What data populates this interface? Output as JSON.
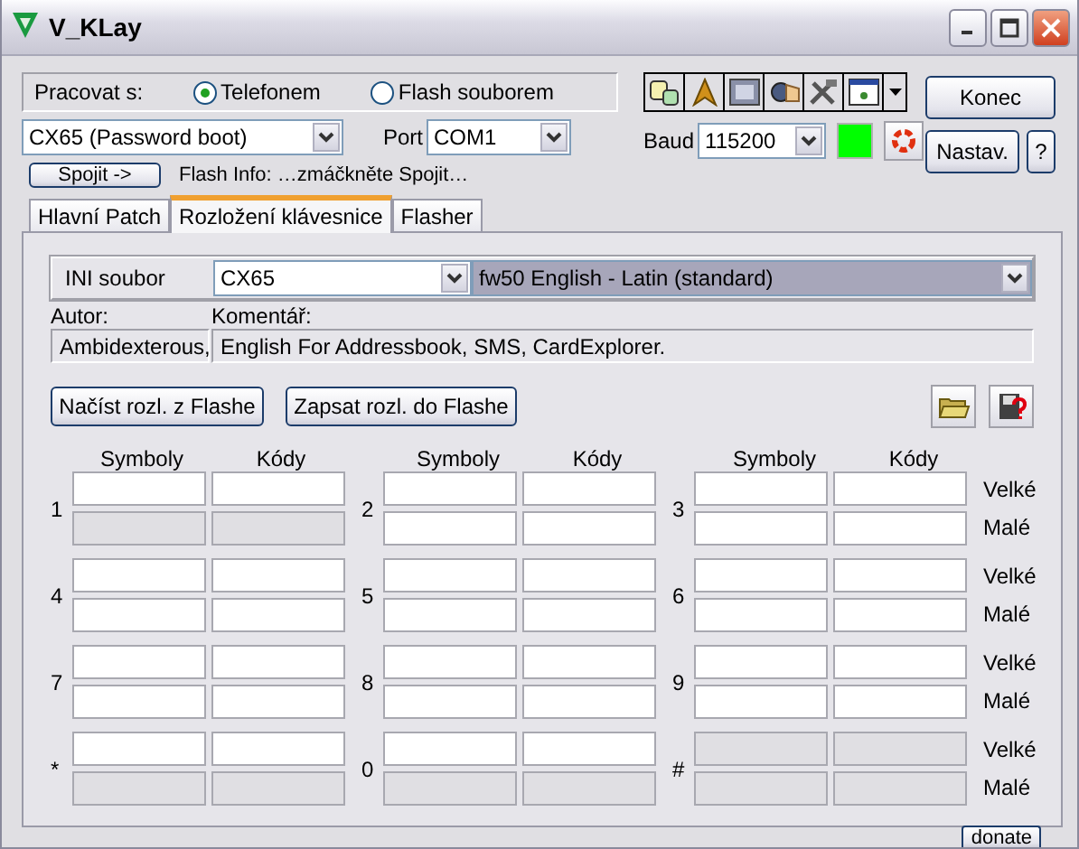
{
  "window": {
    "title": "V_KLay"
  },
  "work_with": {
    "label": "Pracovat s:",
    "options": [
      {
        "label": "Telefonem",
        "selected": true
      },
      {
        "label": "Flash souborem",
        "selected": false
      }
    ]
  },
  "phone_select": {
    "value": "CX65 (Password boot)"
  },
  "port": {
    "label": "Port",
    "value": "COM1"
  },
  "baud": {
    "label": "Baud",
    "value": "115200"
  },
  "connect_button": "Spojit ->",
  "flash_info": "Flash Info: …zmáčkněte Spojit…",
  "close_button": "Konec",
  "settings_button": "Nastav.",
  "help_button": "?",
  "tabs": [
    {
      "label": "Hlavní Patch",
      "selected": false
    },
    {
      "label": "Rozložení klávesnice",
      "selected": true
    },
    {
      "label": "Flasher",
      "selected": false
    }
  ],
  "ini": {
    "label": "INI soubor",
    "file": "CX65",
    "layout": "fw50 English - Latin (standard)",
    "author_label": "Autor:",
    "author": "Ambidexterous,",
    "comment_label": "Komentář:",
    "comment": "English For Addressbook, SMS, CardExplorer."
  },
  "load_button": "Načíst rozl. z Flashe",
  "save_button": "Zapsat rozl. do Flashe",
  "grid": {
    "columns": [
      {
        "symbols": "Symboly",
        "codes": "Kódy"
      },
      {
        "symbols": "Symboly",
        "codes": "Kódy"
      },
      {
        "symbols": "Symboly",
        "codes": "Kódy"
      }
    ],
    "rows": [
      {
        "upper_label": "Velké",
        "lower_label": "Malé",
        "keys": [
          {
            "label": "1",
            "upper_disabled": false,
            "lower_disabled": true
          },
          {
            "label": "2",
            "upper_disabled": false,
            "lower_disabled": false
          },
          {
            "label": "3",
            "upper_disabled": false,
            "lower_disabled": false
          }
        ]
      },
      {
        "upper_label": "Velké",
        "lower_label": "Malé",
        "keys": [
          {
            "label": "4",
            "upper_disabled": false,
            "lower_disabled": false
          },
          {
            "label": "5",
            "upper_disabled": false,
            "lower_disabled": false
          },
          {
            "label": "6",
            "upper_disabled": false,
            "lower_disabled": false
          }
        ]
      },
      {
        "upper_label": "Velké",
        "lower_label": "Malé",
        "keys": [
          {
            "label": "7",
            "upper_disabled": false,
            "lower_disabled": false
          },
          {
            "label": "8",
            "upper_disabled": false,
            "lower_disabled": false
          },
          {
            "label": "9",
            "upper_disabled": false,
            "lower_disabled": false
          }
        ]
      },
      {
        "upper_label": "Velké",
        "lower_label": "Malé",
        "keys": [
          {
            "label": "*",
            "upper_disabled": false,
            "lower_disabled": true
          },
          {
            "label": "0",
            "upper_disabled": false,
            "lower_disabled": true
          },
          {
            "label": "#",
            "upper_disabled": true,
            "lower_disabled": true
          }
        ]
      }
    ]
  },
  "donate_button": "donate"
}
